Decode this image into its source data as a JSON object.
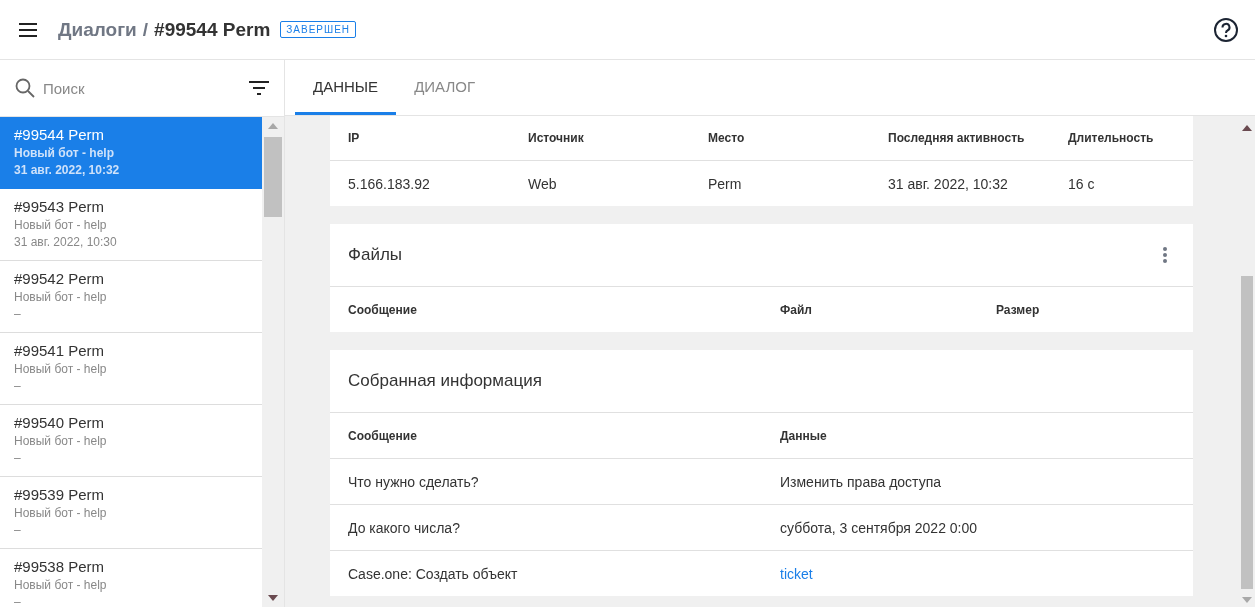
{
  "header": {
    "breadcrumb": "Диалоги",
    "separator": "/",
    "title": "#99544 Perm",
    "status": "ЗАВЕРШЕН"
  },
  "search": {
    "placeholder": "Поиск"
  },
  "dialogs": [
    {
      "title": "#99544 Perm",
      "bot": "Новый бот - help",
      "time": "31 авг. 2022, 10:32",
      "selected": true
    },
    {
      "title": "#99543 Perm",
      "bot": "Новый бот - help",
      "time": "31 авг. 2022, 10:30",
      "selected": false
    },
    {
      "title": "#99542 Perm",
      "bot": "Новый бот - help",
      "time": "–",
      "selected": false
    },
    {
      "title": "#99541 Perm",
      "bot": "Новый бот - help",
      "time": "–",
      "selected": false
    },
    {
      "title": "#99540 Perm",
      "bot": "Новый бот - help",
      "time": "–",
      "selected": false
    },
    {
      "title": "#99539 Perm",
      "bot": "Новый бот - help",
      "time": "–",
      "selected": false
    },
    {
      "title": "#99538 Perm",
      "bot": "Новый бот - help",
      "time": "–",
      "selected": false
    }
  ],
  "tabs": [
    {
      "label": "ДАННЫЕ",
      "selected": true
    },
    {
      "label": "ДИАЛОГ",
      "selected": false
    }
  ],
  "session": {
    "columns": [
      "IP",
      "Источник",
      "Место",
      "Последняя активность",
      "Длительность"
    ],
    "row": [
      "5.166.183.92",
      "Web",
      "Perm",
      "31 авг. 2022, 10:32",
      "16 с"
    ]
  },
  "files": {
    "title": "Файлы",
    "columns": [
      "Сообщение",
      "Файл",
      "Размер"
    ]
  },
  "collected": {
    "title": "Собранная информация",
    "columns": [
      "Сообщение",
      "Данные"
    ],
    "rows": [
      {
        "message": "Что нужно сделать?",
        "data": "Изменить права доступа",
        "kind": "text"
      },
      {
        "message": "До какого числа?",
        "data": "суббота, 3 сентября 2022 0:00",
        "kind": "text"
      },
      {
        "message": "Case.one: Создать объект",
        "data": "ticket",
        "kind": "link"
      }
    ]
  }
}
